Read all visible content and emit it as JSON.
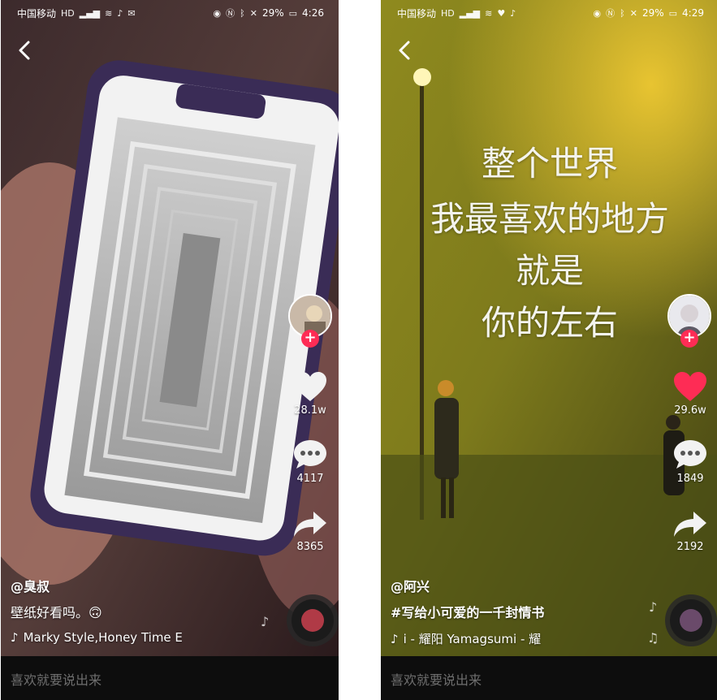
{
  "comment_placeholder": "喜欢就要说出来",
  "left": {
    "status": {
      "carrier": "中国移动",
      "network": "HD",
      "battery": "29%",
      "time": "4:26"
    },
    "author": "@臭叔",
    "caption": "壁纸好看吗。🙃",
    "music": "Marky Style,Honey   Time E",
    "likes": "28.1w",
    "comments": "4117",
    "shares": "8365",
    "liked": false
  },
  "right": {
    "status": {
      "carrier": "中国移动",
      "network": "HD",
      "battery": "29%",
      "time": "4:29"
    },
    "lyrics": [
      "整个世界",
      "我最喜欢的地方",
      "就是",
      "你的左右"
    ],
    "author": "@阿兴",
    "caption": "#写给小可爱的一千封情书",
    "music": "i - 耀阳    Yamagsumi - 耀",
    "likes": "29.6w",
    "comments": "1849",
    "shares": "2192",
    "liked": true
  },
  "colors": {
    "like_active": "#fe2c55",
    "follow_plus": "#fe2c55",
    "comment_bar": "#0d0d0d"
  }
}
